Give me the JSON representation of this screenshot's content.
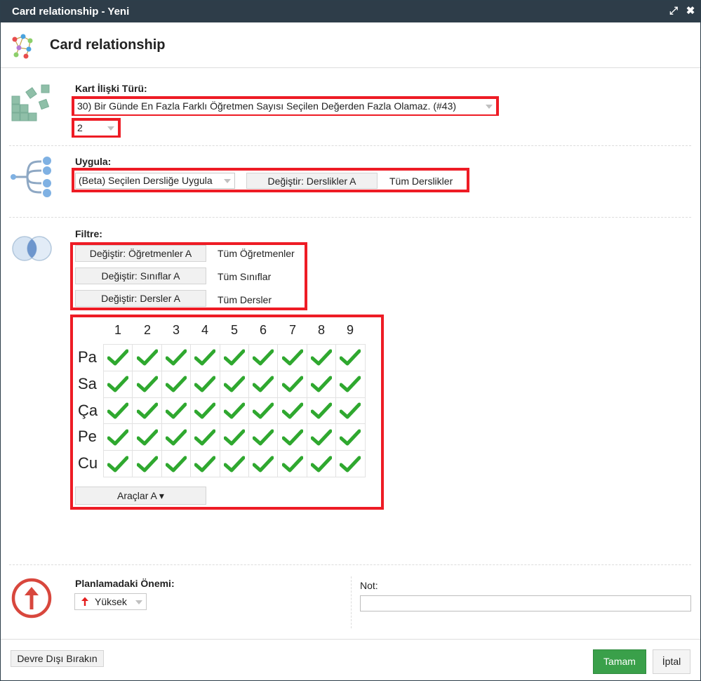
{
  "titlebar": {
    "title": "Card relationship - Yeni"
  },
  "header": {
    "title": "Card relationship"
  },
  "relation_type": {
    "label": "Kart İlişki Türü:",
    "selected": "30) Bir Günde En Fazla Farklı Öğretmen Sayısı Seçilen Değerden Fazla Olamaz. (#43)",
    "value": "2"
  },
  "apply": {
    "label": "Uygula:",
    "mode": "(Beta) Seçilen Dersliğe Uygula",
    "change_button": "Değiştir: Derslikler A",
    "current": "Tüm Derslikler"
  },
  "filter": {
    "label": "Filtre:",
    "rows": [
      {
        "button": "Değiştir: Öğretmenler A",
        "value": "Tüm Öğretmenler"
      },
      {
        "button": "Değiştir: Sınıflar A",
        "value": "Tüm Sınıflar"
      },
      {
        "button": "Değiştir: Dersler A",
        "value": "Tüm Dersler"
      }
    ]
  },
  "grid": {
    "periods": [
      "1",
      "2",
      "3",
      "4",
      "5",
      "6",
      "7",
      "8",
      "9"
    ],
    "days": [
      "Pa",
      "Sa",
      "Ça",
      "Pe",
      "Cu"
    ],
    "checked": [
      [
        true,
        true,
        true,
        true,
        true,
        true,
        true,
        true,
        true
      ],
      [
        true,
        true,
        true,
        true,
        true,
        true,
        true,
        true,
        true
      ],
      [
        true,
        true,
        true,
        true,
        true,
        true,
        true,
        true,
        true
      ],
      [
        true,
        true,
        true,
        true,
        true,
        true,
        true,
        true,
        true
      ],
      [
        true,
        true,
        true,
        true,
        true,
        true,
        true,
        true,
        true
      ]
    ],
    "tools_button": "Araçlar A ▾"
  },
  "importance": {
    "label": "Planlamadaki Önemi:",
    "selected": "Yüksek"
  },
  "note": {
    "label": "Not:",
    "value": ""
  },
  "footer": {
    "disable_button": "Devre Dışı Bırakın",
    "ok_button": "Tamam",
    "cancel_button": "İptal"
  },
  "colors": {
    "titlebar": "#2e3d49",
    "highlight": "#ee1c25",
    "check": "#2fa82f",
    "primary": "#3aa04a"
  }
}
